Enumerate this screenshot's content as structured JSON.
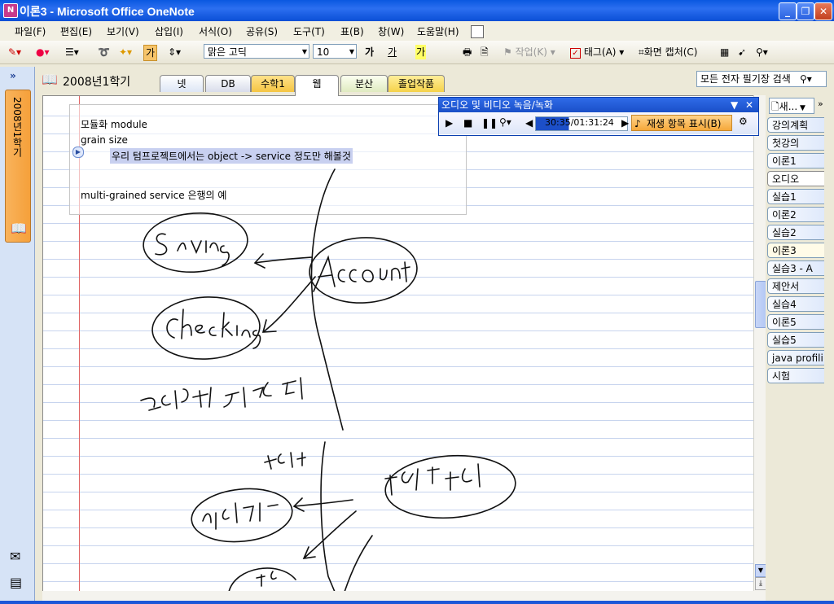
{
  "window": {
    "title": "이론3 - Microsoft Office OneNote",
    "app_icon": "N"
  },
  "menu": [
    "파일(F)",
    "편집(E)",
    "보기(V)",
    "삽입(I)",
    "서식(O)",
    "공유(S)",
    "도구(T)",
    "표(B)",
    "창(W)",
    "도움말(H)"
  ],
  "toolbar": {
    "font_name": "맑은 고딕",
    "font_size": "10",
    "bold_label": "가",
    "underline_label": "가",
    "style_label": "가",
    "tag_disabled_label": "작업(K)",
    "tag_label": "태그(A)",
    "screen_clip_label": "화면 캡처(C)"
  },
  "notebook": {
    "name": "2008년1학기",
    "sections": [
      "넷",
      "DB",
      "수학1",
      "웹",
      "분산",
      "졸업작품"
    ],
    "active_section": "웹",
    "search_label": "모든 전자 필기장 검색"
  },
  "nav": {
    "expand_label": "»",
    "notebook_vertical": "2008년1학기"
  },
  "note": {
    "line1": "모듈화 module",
    "line2": "grain size",
    "line3": "우리 텀프로젝트에서는  object -> service 정도만 해볼것",
    "line4": "multi-grained service 은행의 예"
  },
  "audio_panel": {
    "title": "오디오 및 비디오 녹음/녹화",
    "time": "30:35/01:31:24",
    "playback_label": "재생 항목 표시(B)"
  },
  "pages": {
    "new_label": "새...",
    "items": [
      "강의계획",
      "첫강의",
      "이론1",
      "오디오",
      "실습1",
      "이론2",
      "실습2",
      "이론3",
      "실습3 - A",
      "제안서",
      "실습4",
      "이론5",
      "실습5",
      "java profili",
      "시험"
    ],
    "active": "이론3"
  },
  "colors": {
    "titlebar": "#0a58e0",
    "section_active": "#ffffff",
    "tab_math": "#f5c542",
    "tab_grad": "#f5d24a",
    "highlight": "#c8d0f0"
  }
}
